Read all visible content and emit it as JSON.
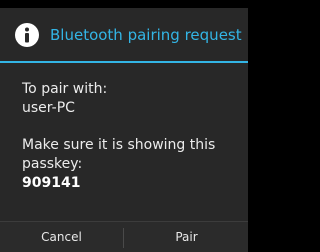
{
  "dialog": {
    "title": "Bluetooth pairing request",
    "icon": "info-icon",
    "accent_color": "#33b5e5",
    "body": {
      "line1": "To pair with:",
      "device_name": "user-PC",
      "instruction": "Make sure it is showing this passkey:",
      "passkey": "909141"
    },
    "buttons": {
      "cancel": "Cancel",
      "pair": "Pair"
    }
  }
}
